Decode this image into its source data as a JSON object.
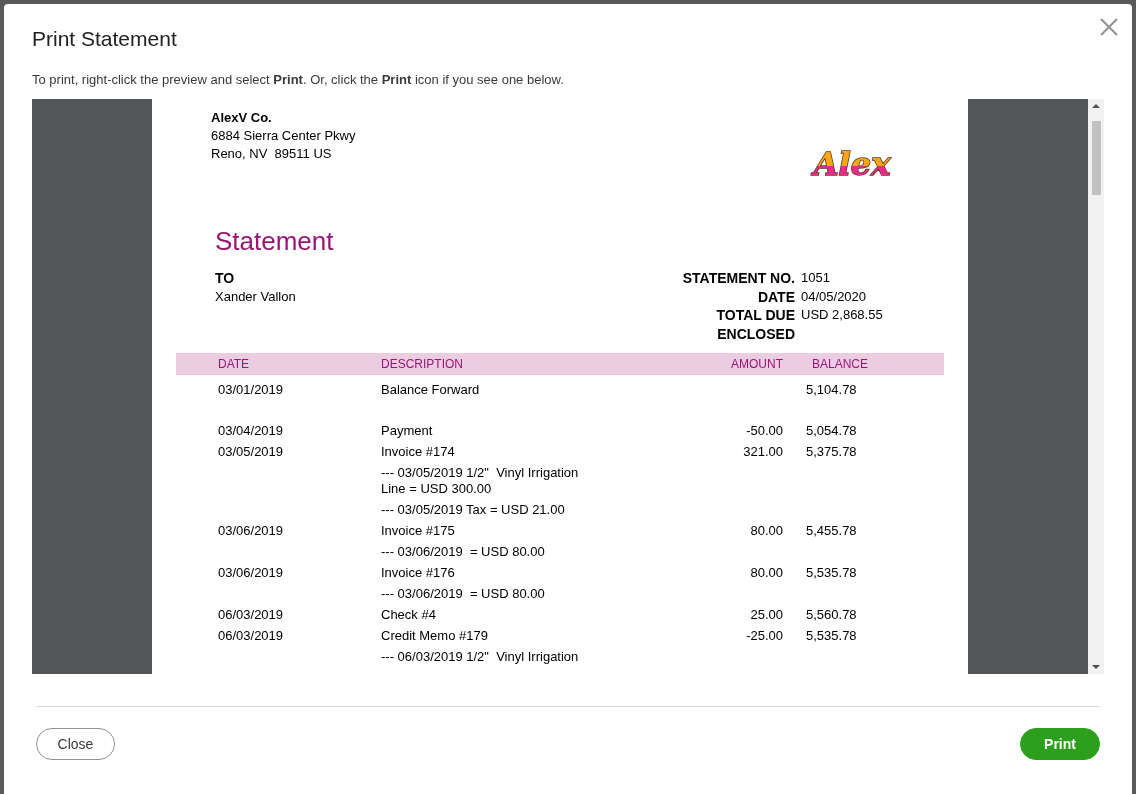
{
  "dialog": {
    "title": "Print Statement",
    "instructions": "To print, right-click the preview and select **Print**. Or, click the **Print** icon if you see one below."
  },
  "statement": {
    "company": {
      "name": "AlexV Co.",
      "address_lines": [
        "6884 Sierra Center Pkwy",
        "Reno, NV  89511 US"
      ]
    },
    "logo_text": "Alex",
    "heading": "Statement",
    "to_label": "TO",
    "customer": "Xander Vallon",
    "fields": [
      {
        "label": "STATEMENT NO.",
        "value": "1051"
      },
      {
        "label": "DATE",
        "value": "04/05/2020"
      },
      {
        "label": "TOTAL DUE",
        "value": "USD 2,868.55"
      },
      {
        "label": "ENCLOSED"
      }
    ],
    "table": {
      "columns": [
        "DATE",
        "DESCRIPTION",
        "AMOUNT",
        "BALANCE"
      ],
      "rows": [
        {
          "kind": "balance_forward",
          "date": "03/01/2019",
          "description": "Balance Forward",
          "balance": "5,104.78"
        },
        {
          "kind": "transaction",
          "date": "03/04/2019",
          "description": "Payment",
          "amount": "-50.00",
          "balance": "5,054.78"
        },
        {
          "kind": "transaction",
          "date": "03/05/2019",
          "description": "Invoice #174",
          "amount": "321.00",
          "balance": "5,375.78",
          "details": [
            "--- 03/05/2019 1/2\"  Vinyl Irrigation Line = USD 300.00",
            "--- 03/05/2019 Tax = USD 21.00"
          ]
        },
        {
          "kind": "transaction",
          "date": "03/06/2019",
          "description": "Invoice #175",
          "amount": "80.00",
          "balance": "5,455.78",
          "details": [
            "--- 03/06/2019  = USD 80.00"
          ]
        },
        {
          "kind": "transaction",
          "date": "03/06/2019",
          "description": "Invoice #176",
          "amount": "80.00",
          "balance": "5,535.78",
          "details": [
            "--- 03/06/2019  = USD 80.00"
          ]
        },
        {
          "kind": "transaction",
          "date": "06/03/2019",
          "description": "Check #4",
          "amount": "25.00",
          "balance": "5,560.78"
        },
        {
          "kind": "transaction",
          "date": "06/03/2019",
          "description": "Credit Memo #179",
          "amount": "-25.00",
          "balance": "5,535.78",
          "details": [
            "--- 06/03/2019 1/2\"  Vinyl Irrigation"
          ]
        }
      ]
    }
  },
  "buttons": [
    {
      "label": "Close",
      "kind": "secondary"
    },
    {
      "label": "Print",
      "kind": "primary"
    }
  ]
}
